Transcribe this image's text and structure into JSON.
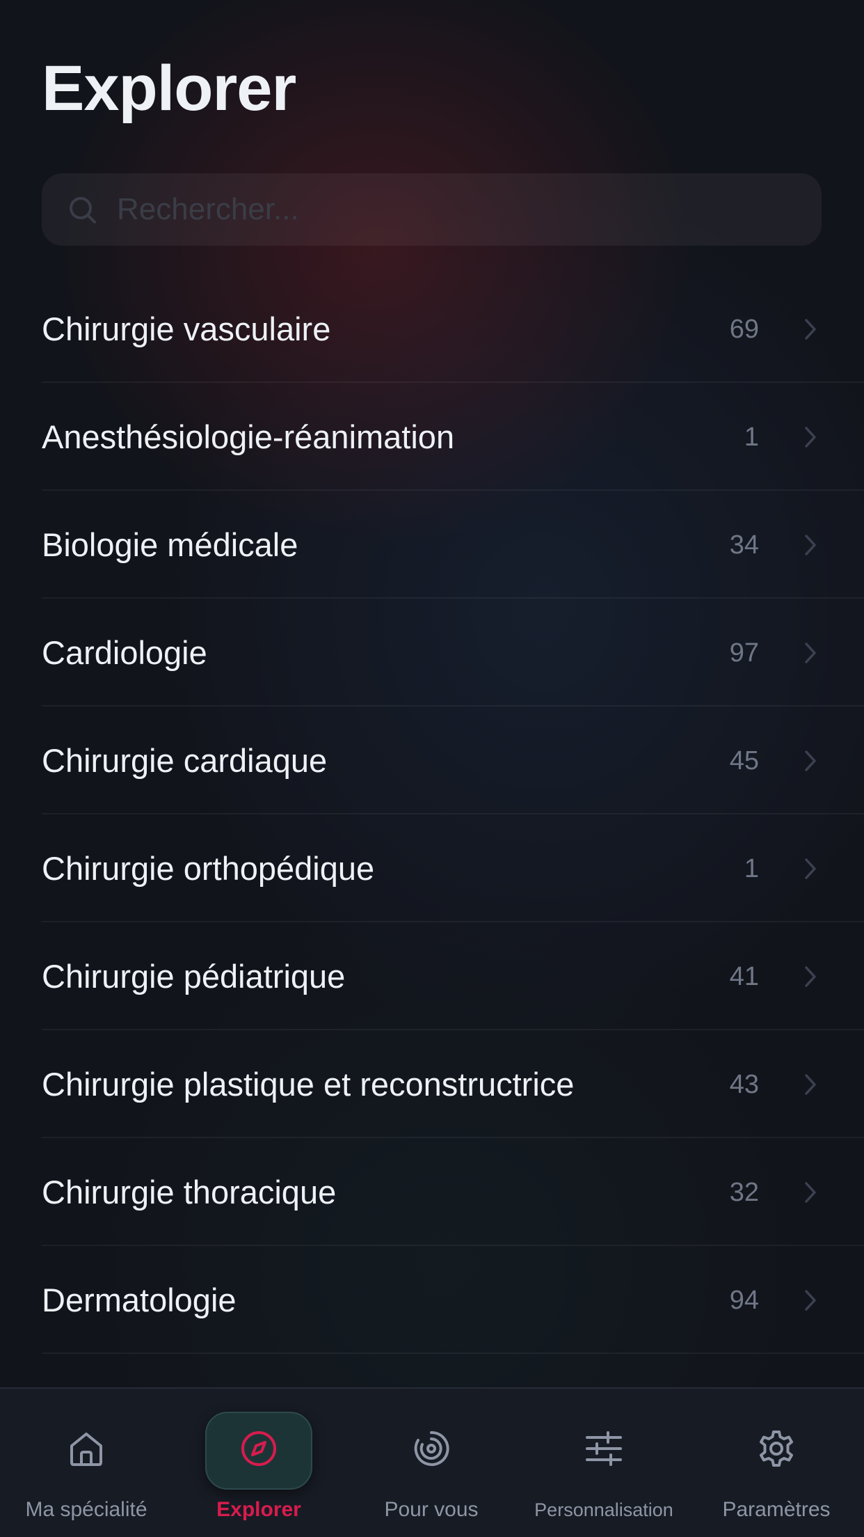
{
  "header": {
    "title": "Explorer"
  },
  "search": {
    "placeholder": "Rechercher..."
  },
  "specialties": [
    {
      "label": "Chirurgie vasculaire",
      "count": "69"
    },
    {
      "label": "Anesthésiologie-réanimation",
      "count": "1"
    },
    {
      "label": "Biologie médicale",
      "count": "34"
    },
    {
      "label": "Cardiologie",
      "count": "97"
    },
    {
      "label": "Chirurgie cardiaque",
      "count": "45"
    },
    {
      "label": "Chirurgie orthopédique",
      "count": "1"
    },
    {
      "label": "Chirurgie pédiatrique",
      "count": "41"
    },
    {
      "label": "Chirurgie plastique et reconstructrice",
      "count": "43"
    },
    {
      "label": "Chirurgie thoracique",
      "count": "32"
    },
    {
      "label": "Dermatologie",
      "count": "94"
    }
  ],
  "tab_bar": {
    "active_tab": "explorer",
    "tabs": [
      {
        "id": "ma-specialite",
        "label": "Ma spécialité",
        "icon": "home-icon"
      },
      {
        "id": "explorer",
        "label": "Explorer",
        "icon": "compass-icon"
      },
      {
        "id": "pour-vous",
        "label": "Pour vous",
        "icon": "radar-icon"
      },
      {
        "id": "personnalisation",
        "label": "Personnalisation",
        "icon": "sliders-icon"
      },
      {
        "id": "parametres",
        "label": "Paramètres",
        "icon": "gear-icon"
      }
    ]
  },
  "colors": {
    "accent": "#d81c4d",
    "background": "#12141b",
    "tab_bar_background": "#171b24",
    "text_primary": "#eef1f6",
    "text_muted": "#6f7787"
  }
}
